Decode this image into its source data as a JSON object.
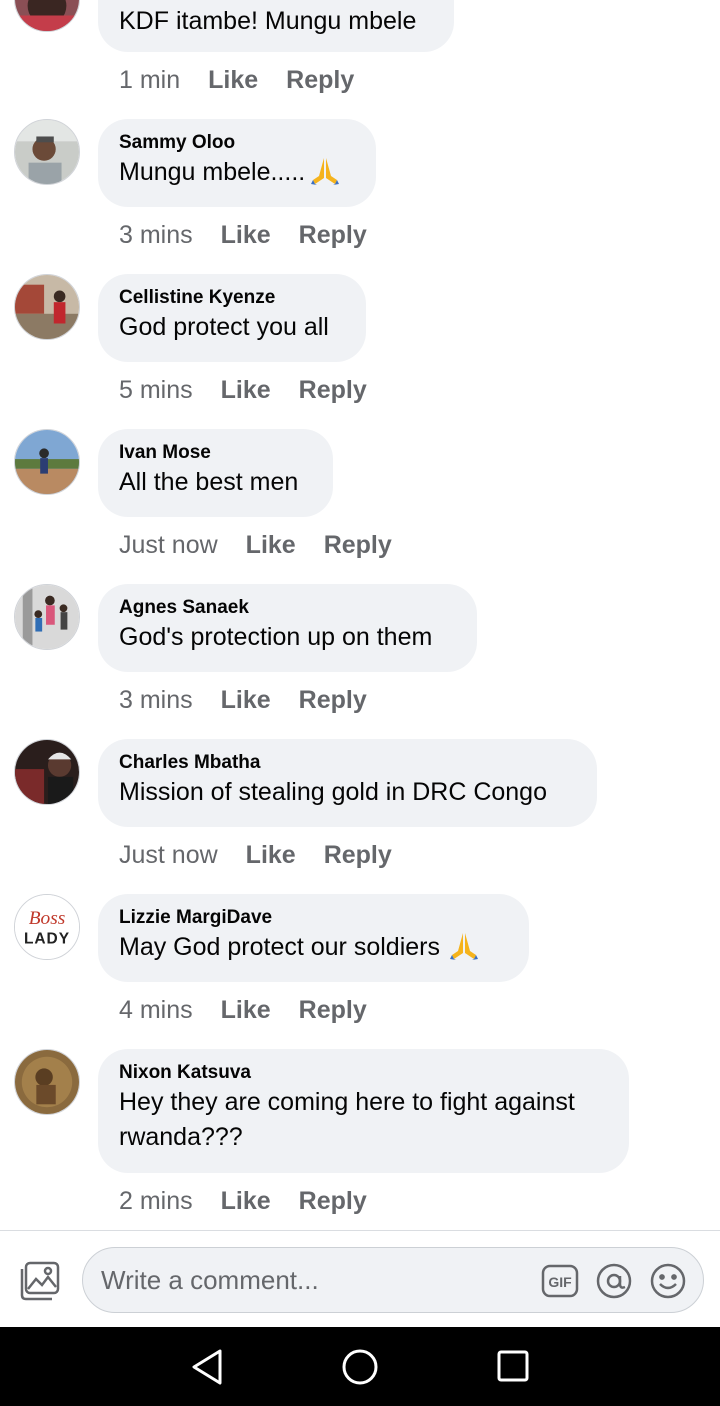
{
  "comments": [
    {
      "author": "",
      "text": "KDF itambe! Mungu mbele",
      "time": "1 min",
      "like": "Like",
      "reply": "Reply"
    },
    {
      "author": "Sammy Oloo",
      "text": "Mungu mbele.....",
      "time": "3 mins",
      "like": "Like",
      "reply": "Reply"
    },
    {
      "author": "Cellistine Kyenze",
      "text": "God protect you all",
      "time": "5 mins",
      "like": "Like",
      "reply": "Reply"
    },
    {
      "author": "Ivan Mose",
      "text": "All the best men",
      "time": "Just now",
      "like": "Like",
      "reply": "Reply"
    },
    {
      "author": "Agnes Sanaek",
      "text": "God's protection up on them",
      "time": "3 mins",
      "like": "Like",
      "reply": "Reply"
    },
    {
      "author": "Charles Mbatha",
      "text": "Mission of stealing gold in DRC Congo",
      "time": "Just now",
      "like": "Like",
      "reply": "Reply"
    },
    {
      "author": "Lizzie MargiDave",
      "text": "May God protect our soldiers",
      "time": "4 mins",
      "like": "Like",
      "reply": "Reply"
    },
    {
      "author": "Nixon Katsuva",
      "text_line1": "Hey they are coming here to fight against",
      "text_line2": "rwanda???",
      "time": "2 mins",
      "like": "Like",
      "reply": "Reply"
    }
  ],
  "avatar_labels": {
    "boss_lady_top": "Boss",
    "boss_lady_bottom": "LADY"
  },
  "composer": {
    "placeholder": "Write a comment...",
    "gif_label": "GIF"
  },
  "colors": {
    "bubble": "#f0f2f5",
    "meta_text": "#65676b",
    "text": "#050505",
    "emoji_prayer": "#f5b31c"
  },
  "icons": [
    "photo-icon",
    "gif-icon",
    "mention-icon",
    "emoji-icon",
    "back-icon",
    "home-icon",
    "recent-apps-icon",
    "folded-hands-emoji"
  ]
}
